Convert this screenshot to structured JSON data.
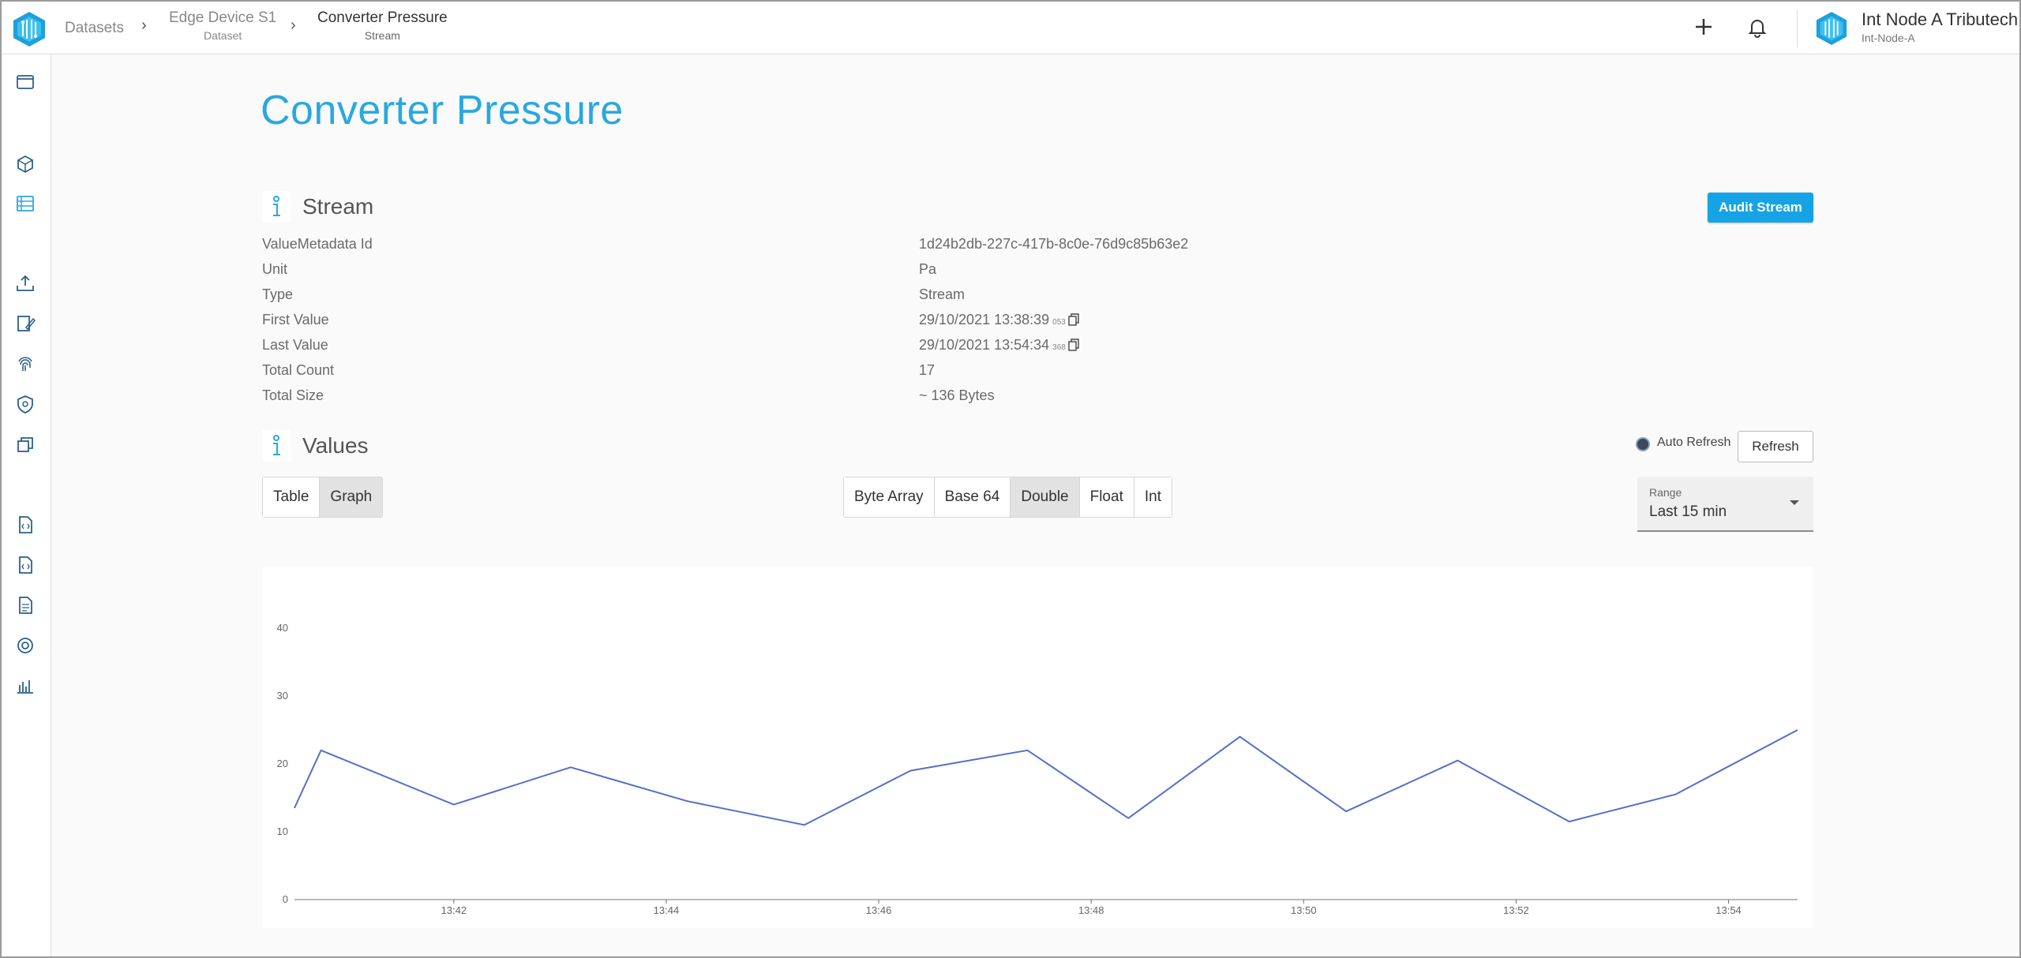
{
  "breadcrumb": {
    "items": [
      {
        "label": "Datasets"
      },
      {
        "label": "Edge Device S1",
        "sub": "Dataset"
      },
      {
        "label": "Converter Pressure",
        "sub": "Stream"
      }
    ]
  },
  "user": {
    "name": "Int Node A Tributech",
    "sub": "Int-Node-A"
  },
  "page": {
    "title": "Converter Pressure"
  },
  "stream_section": {
    "title": "Stream",
    "audit_button": "Audit Stream",
    "rows": [
      {
        "key": "ValueMetadata Id",
        "value": "1d24b2db-227c-417b-8c0e-76d9c85b63e2"
      },
      {
        "key": "Unit",
        "value": "Pa"
      },
      {
        "key": "Type",
        "value": "Stream"
      },
      {
        "key": "First Value",
        "value": "29/10/2021 13:38:39",
        "suffix": "053"
      },
      {
        "key": "Last Value",
        "value": "29/10/2021 13:54:34",
        "suffix": "368"
      },
      {
        "key": "Total Count",
        "value": "17"
      },
      {
        "key": "Total Size",
        "value": "~ 136 Bytes"
      }
    ]
  },
  "values_section": {
    "title": "Values",
    "auto_refresh_label": "Auto Refresh",
    "refresh_button": "Refresh",
    "view_tabs": [
      "Table",
      "Graph"
    ],
    "active_view": "Graph",
    "format_tabs": [
      "Byte Array",
      "Base 64",
      "Double",
      "Float",
      "Int"
    ],
    "active_format": "Double",
    "range": {
      "label": "Range",
      "value": "Last 15 min"
    }
  },
  "colors": {
    "accent": "#29a8e0",
    "button": "#16a3e6",
    "series": "#5470c6"
  },
  "chart_data": {
    "type": "line",
    "x_unit": "minutes",
    "x": [
      40.5,
      40.75,
      42.0,
      43.1,
      44.2,
      45.3,
      46.3,
      47.4,
      48.35,
      49.4,
      50.4,
      51.45,
      52.5,
      53.5,
      54.65
    ],
    "y": [
      13.5,
      22,
      14,
      19.5,
      14.5,
      11,
      19,
      22,
      12,
      24,
      13,
      20.5,
      11.5,
      15.5,
      25
    ],
    "xlim": [
      40.5,
      54.65
    ],
    "ylim": [
      0,
      40
    ],
    "x_ticks": [
      "13:42",
      "13:44",
      "13:46",
      "13:48",
      "13:50",
      "13:52",
      "13:54"
    ],
    "x_tick_values": [
      42,
      44,
      46,
      48,
      50,
      52,
      54
    ],
    "y_ticks": [
      0,
      10,
      20,
      30,
      40
    ],
    "title": "",
    "xlabel": "",
    "ylabel": "",
    "grid": false
  }
}
